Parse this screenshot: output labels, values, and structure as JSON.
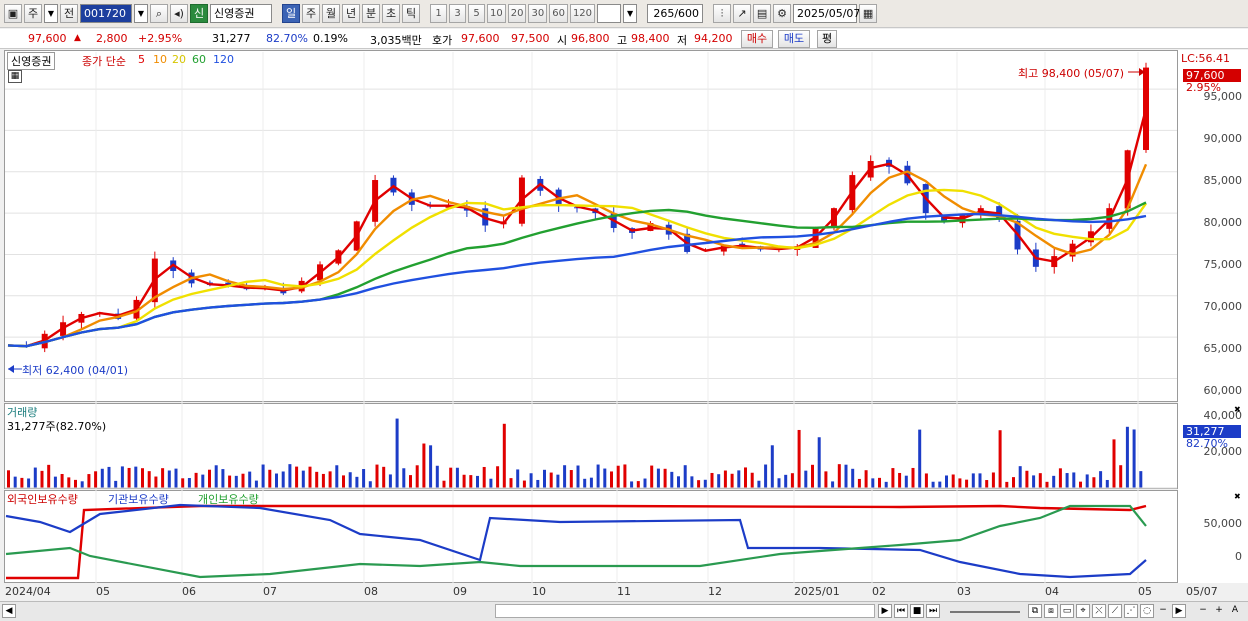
{
  "toolbar": {
    "period_unit": "주",
    "prev_label": "전",
    "stock_code": "001720",
    "stock_badge": "신",
    "stock_name": "신영증권",
    "periods": [
      "일",
      "주",
      "월",
      "년",
      "분",
      "초",
      "틱"
    ],
    "active_period": "일",
    "intervals": [
      "1",
      "3",
      "5",
      "10",
      "20",
      "30",
      "60",
      "120"
    ],
    "count_display": "265/600",
    "date": "2025/05/07"
  },
  "quote": {
    "price": "97,600",
    "change": "2,800",
    "change_pct": "+2.95%",
    "volume": "31,277",
    "volume_ratio": "82.70%",
    "turnover": "0.19%",
    "amount": "3,035백만",
    "ask_label": "호가",
    "ask": "97,600",
    "bid": "97,500",
    "open_label": "시",
    "open": "96,800",
    "high_label": "고",
    "high": "98,400",
    "low_label": "저",
    "low": "94,200",
    "buy_label": "매수",
    "sell_label": "매도",
    "flat_label": "평"
  },
  "price_panel": {
    "legend_name": "신영증권",
    "ma_label": "종가 단순",
    "ma_periods": [
      "5",
      "10",
      "20",
      "60",
      "120"
    ],
    "ma_colors": [
      "#e00000",
      "#f08c00",
      "#f0e000",
      "#22a030",
      "#2050e0"
    ],
    "max_annotation": "최고 98,400 (05/07)",
    "min_annotation": "최저 62,400 (04/01)",
    "lc_label": "LC:56.41",
    "price_badge": "97,600",
    "price_pct": "2.95%",
    "y_ticks": [
      "95,000",
      "90,000",
      "85,000",
      "80,000",
      "75,000",
      "70,000",
      "65,000",
      "60,000"
    ]
  },
  "volume_panel": {
    "title": "거래량",
    "info": "31,277주(82.70%)",
    "y_ticks": [
      "40,000",
      "20,000"
    ],
    "badge": "31,277",
    "badge_pct": "82.70%"
  },
  "holding_panel": {
    "series": [
      "외국인보유수량",
      "기관보유수량",
      "개인보유수량"
    ],
    "y_ticks": [
      "50,000",
      "0"
    ]
  },
  "x_axis": [
    "2024/04",
    "05",
    "06",
    "07",
    "08",
    "09",
    "10",
    "11",
    "12",
    "2025/01",
    "02",
    "03",
    "04",
    "05",
    "05/07"
  ],
  "chart_data": {
    "type": "candlestick",
    "x_start": "2024/04/01",
    "x_end": "2025/05/07",
    "ylim": [
      58000,
      99000
    ],
    "close": [
      64000,
      63800,
      65400,
      66800,
      67800,
      68000,
      67200,
      69500,
      74500,
      73000,
      71500,
      71300,
      71200,
      70800,
      71000,
      70300,
      71800,
      73800,
      75500,
      79000,
      84000,
      82500,
      81000,
      80800,
      81000,
      80300,
      78500,
      79000,
      84300,
      82700,
      81000,
      80600,
      80000,
      78200,
      77600,
      78800,
      77400,
      75300,
      75600,
      76100,
      76000,
      75600,
      75700,
      76000,
      78200,
      80600,
      84600,
      86300,
      85600,
      83600,
      80000,
      78900,
      79800,
      80600,
      79300,
      75600,
      73500,
      74800,
      76300,
      77800,
      80600,
      87600,
      97600
    ]
  }
}
